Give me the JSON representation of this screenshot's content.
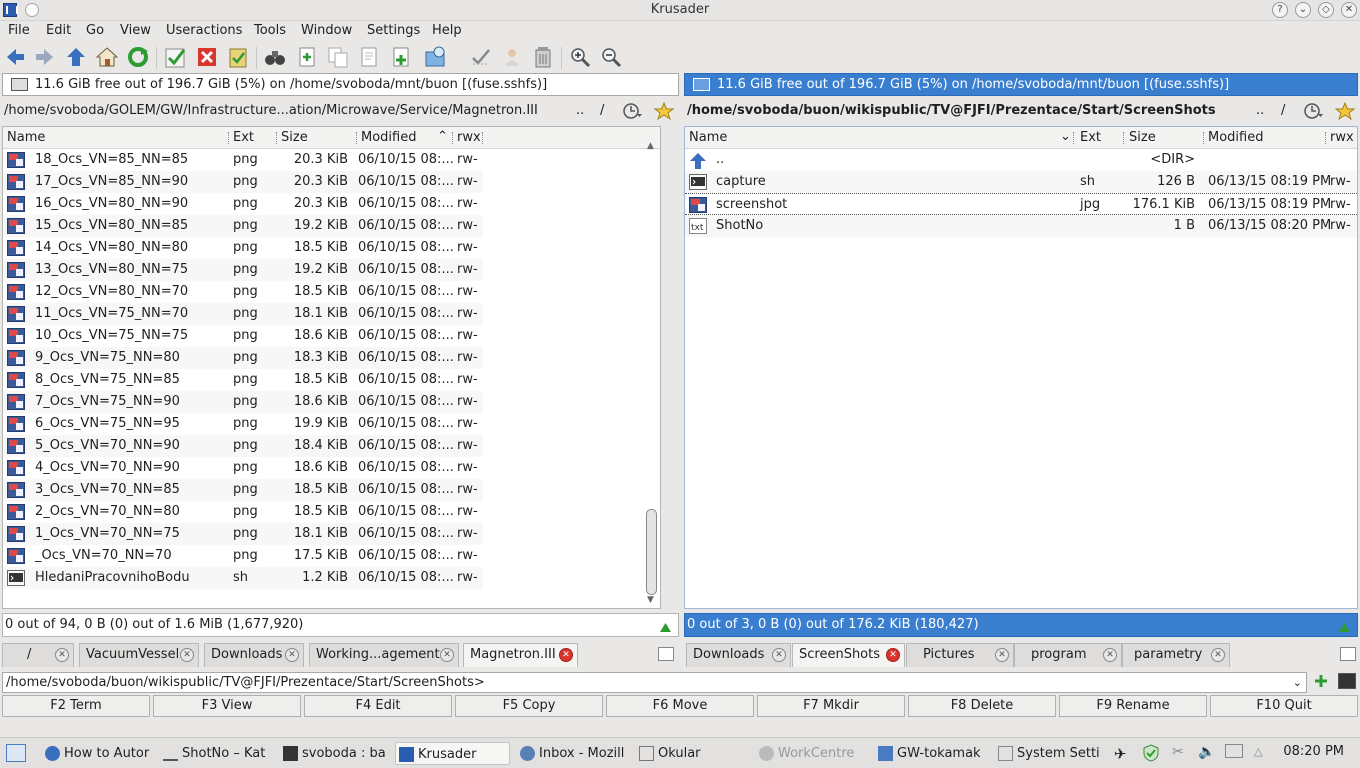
{
  "window": {
    "title": "Krusader"
  },
  "menu": [
    "File",
    "Edit",
    "Go",
    "View",
    "Useractions",
    "Tools",
    "Window",
    "Settings",
    "Help"
  ],
  "toolbar": {
    "icons": [
      "back-icon",
      "forward-icon",
      "up-icon",
      "home-icon",
      "refresh-icon",
      "select-all-icon",
      "unselect-icon",
      "paste-icon",
      "search-icon",
      "new-file-icon",
      "copy-icon",
      "view-file-icon",
      "new-folder-icon",
      "mount-icon",
      "compare-icon",
      "user-icon",
      "archive-icon",
      "zoom-in-icon",
      "zoom-out-icon"
    ]
  },
  "left_panel": {
    "disk_info": "11.6 GiB free out of 196.7 GiB (5%) on /home/svoboda/mnt/buon [(fuse.sshfs)]",
    "path": "/home/svoboda/GOLEM/GW/Infrastructure...ation/Microwave/Service/Magnetron.III",
    "path_up": "..",
    "path_root": "/",
    "columns": {
      "name": "Name",
      "ext": "Ext",
      "size": "Size",
      "modified": "Modified",
      "rwx": "rwx"
    },
    "files": [
      {
        "name": "18_Ocs_VN=85_NN=85",
        "ext": "png",
        "size": "20.3 KiB",
        "modified": "06/10/15 08:...",
        "rwx": "rw-",
        "icon": "image"
      },
      {
        "name": "17_Ocs_VN=85_NN=90",
        "ext": "png",
        "size": "20.3 KiB",
        "modified": "06/10/15 08:...",
        "rwx": "rw-",
        "icon": "image"
      },
      {
        "name": "16_Ocs_VN=80_NN=90",
        "ext": "png",
        "size": "20.3 KiB",
        "modified": "06/10/15 08:...",
        "rwx": "rw-",
        "icon": "image"
      },
      {
        "name": "15_Ocs_VN=80_NN=85",
        "ext": "png",
        "size": "19.2 KiB",
        "modified": "06/10/15 08:...",
        "rwx": "rw-",
        "icon": "image"
      },
      {
        "name": "14_Ocs_VN=80_NN=80",
        "ext": "png",
        "size": "18.5 KiB",
        "modified": "06/10/15 08:...",
        "rwx": "rw-",
        "icon": "image"
      },
      {
        "name": "13_Ocs_VN=80_NN=75",
        "ext": "png",
        "size": "19.2 KiB",
        "modified": "06/10/15 08:...",
        "rwx": "rw-",
        "icon": "image"
      },
      {
        "name": "12_Ocs_VN=80_NN=70",
        "ext": "png",
        "size": "18.5 KiB",
        "modified": "06/10/15 08:...",
        "rwx": "rw-",
        "icon": "image"
      },
      {
        "name": "11_Ocs_VN=75_NN=70",
        "ext": "png",
        "size": "18.1 KiB",
        "modified": "06/10/15 08:...",
        "rwx": "rw-",
        "icon": "image"
      },
      {
        "name": "10_Ocs_VN=75_NN=75",
        "ext": "png",
        "size": "18.6 KiB",
        "modified": "06/10/15 08:...",
        "rwx": "rw-",
        "icon": "image"
      },
      {
        "name": "9_Ocs_VN=75_NN=80",
        "ext": "png",
        "size": "18.3 KiB",
        "modified": "06/10/15 08:...",
        "rwx": "rw-",
        "icon": "image"
      },
      {
        "name": "8_Ocs_VN=75_NN=85",
        "ext": "png",
        "size": "18.5 KiB",
        "modified": "06/10/15 08:...",
        "rwx": "rw-",
        "icon": "image"
      },
      {
        "name": "7_Ocs_VN=75_NN=90",
        "ext": "png",
        "size": "18.6 KiB",
        "modified": "06/10/15 08:...",
        "rwx": "rw-",
        "icon": "image"
      },
      {
        "name": "6_Ocs_VN=75_NN=95",
        "ext": "png",
        "size": "19.9 KiB",
        "modified": "06/10/15 08:...",
        "rwx": "rw-",
        "icon": "image"
      },
      {
        "name": "5_Ocs_VN=70_NN=90",
        "ext": "png",
        "size": "18.4 KiB",
        "modified": "06/10/15 08:...",
        "rwx": "rw-",
        "icon": "image"
      },
      {
        "name": "4_Ocs_VN=70_NN=90",
        "ext": "png",
        "size": "18.6 KiB",
        "modified": "06/10/15 08:...",
        "rwx": "rw-",
        "icon": "image"
      },
      {
        "name": "3_Ocs_VN=70_NN=85",
        "ext": "png",
        "size": "18.5 KiB",
        "modified": "06/10/15 08:...",
        "rwx": "rw-",
        "icon": "image"
      },
      {
        "name": "2_Ocs_VN=70_NN=80",
        "ext": "png",
        "size": "18.5 KiB",
        "modified": "06/10/15 08:...",
        "rwx": "rw-",
        "icon": "image"
      },
      {
        "name": "1_Ocs_VN=70_NN=75",
        "ext": "png",
        "size": "18.1 KiB",
        "modified": "06/10/15 08:...",
        "rwx": "rw-",
        "icon": "image"
      },
      {
        "name": "_Ocs_VN=70_NN=70",
        "ext": "png",
        "size": "17.5 KiB",
        "modified": "06/10/15 08:...",
        "rwx": "rw-",
        "icon": "image"
      },
      {
        "name": "HledaniPracovnihoBodu",
        "ext": "sh",
        "size": "1.2 KiB",
        "modified": "06/10/15 08:...",
        "rwx": "rw-",
        "icon": "script"
      }
    ],
    "status": "0 out of 94, 0 B (0) out of 1.6 MiB (1,677,920)",
    "tabs": [
      "/",
      "VacuumVessel",
      "Downloads",
      "Working...agement",
      "Magnetron.III"
    ],
    "current_tab": 4
  },
  "right_panel": {
    "disk_info": "11.6 GiB free out of 196.7 GiB (5%) on /home/svoboda/mnt/buon [(fuse.sshfs)]",
    "path": "/home/svoboda/buon/wikispublic/TV@FJFI/Prezentace/Start/ScreenShots",
    "path_up": "..",
    "path_root": "/",
    "columns": {
      "name": "Name",
      "ext": "Ext",
      "size": "Size",
      "modified": "Modified",
      "rwx": "rwx"
    },
    "files": [
      {
        "name": "..",
        "ext": "",
        "size": "<DIR>",
        "modified": "",
        "rwx": "",
        "icon": "up"
      },
      {
        "name": "capture",
        "ext": "sh",
        "size": "126 B",
        "modified": "06/13/15 08:19 PM",
        "rwx": "rw-",
        "icon": "script"
      },
      {
        "name": "screenshot",
        "ext": "jpg",
        "size": "176.1 KiB",
        "modified": "06/13/15 08:19 PM",
        "rwx": "rw-",
        "icon": "image"
      },
      {
        "name": "ShotNo",
        "ext": "",
        "size": "1 B",
        "modified": "06/13/15 08:20 PM",
        "rwx": "rw-",
        "icon": "text"
      }
    ],
    "status": "0 out of 3, 0 B (0) out of 176.2 KiB (180,427)",
    "tabs": [
      "Downloads",
      "ScreenShots",
      "Pictures",
      "program",
      "parametry"
    ],
    "current_tab": 1
  },
  "command_line": {
    "value": "/home/svoboda/buon/wikispublic/TV@FJFI/Prezentace/Start/ScreenShots>"
  },
  "function_keys": [
    "F2 Term",
    "F3 View",
    "F4 Edit",
    "F5 Copy",
    "F6 Move",
    "F7 Mkdir",
    "F8 Delete",
    "F9 Rename",
    "F10 Quit"
  ],
  "taskbar": {
    "tasks": [
      "How to Autor",
      "ShotNo – Kat",
      "svoboda : ba",
      "Krusader",
      "Inbox - Mozill",
      "Okular",
      "WorkCentre",
      "GW-tokamak",
      "System Setti"
    ],
    "clock": "08:20 PM"
  },
  "colors": {
    "accent": "#3a7fcf",
    "close_red": "#d9362e"
  }
}
